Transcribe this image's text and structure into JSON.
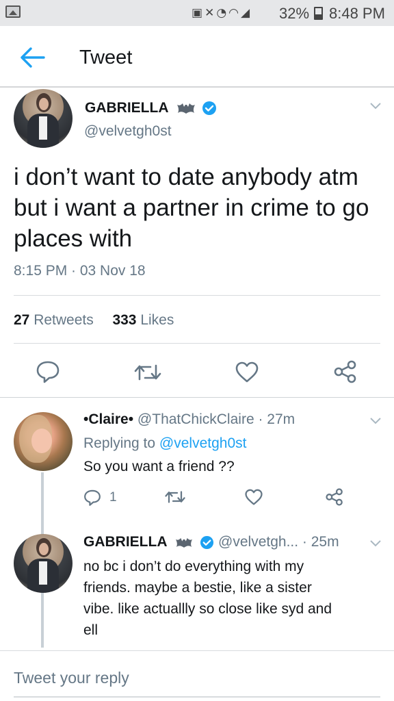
{
  "status_bar": {
    "battery": "32%",
    "time": "8:48 PM",
    "icons": [
      "gallery-icon",
      "nfc-icon",
      "mute-icon",
      "alarm-icon",
      "wifi-icon",
      "signal-icon",
      "battery-icon"
    ]
  },
  "header": {
    "title": "Tweet"
  },
  "main_tweet": {
    "name": "GABRIELLA",
    "handle": "@velvetgh0st",
    "text": "i don’t want to date anybody atm but i want a partner in crime to go places with",
    "timestamp": "8:15 PM · 03 Nov 18",
    "retweets_count": "27",
    "retweets_label": "Retweets",
    "likes_count": "333",
    "likes_label": "Likes"
  },
  "replies": [
    {
      "name": "•Claire•",
      "handle": "@ThatChickClaire",
      "time": "· 27m",
      "replying_label": "Replying to",
      "replying_to": "@velvetgh0st",
      "text": "So you want a friend ??",
      "reply_count": "1"
    },
    {
      "name": "GABRIELLA",
      "handle": "@velvetgh...",
      "time": "· 25m",
      "text_lines": [
        "no bc i don’t do everything with my",
        "friends. maybe a bestie, like a sister",
        "vibe. like actuallly so close like syd and",
        "ell"
      ]
    }
  ],
  "composer": {
    "placeholder": "Tweet your reply"
  },
  "colors": {
    "accent": "#1da1f2",
    "muted": "#657786",
    "text": "#14171a"
  }
}
